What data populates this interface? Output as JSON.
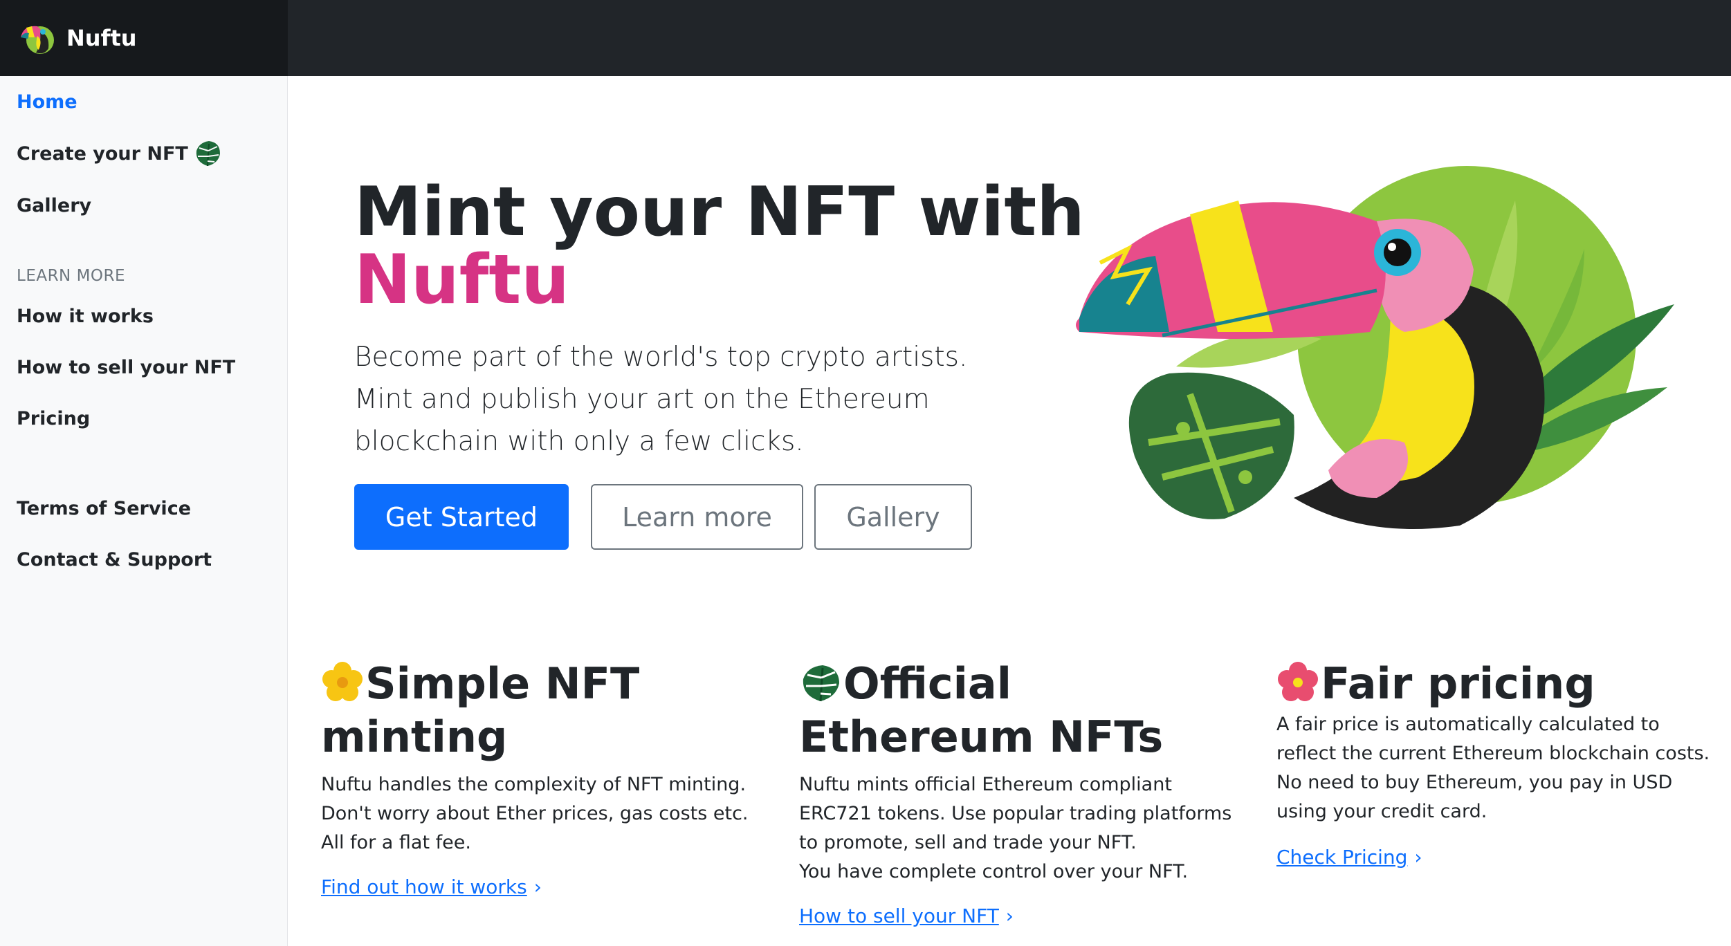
{
  "brand": {
    "name": "Nuftu",
    "logo_icon": "toucan-logo-icon"
  },
  "sidebar": {
    "items": [
      {
        "label": "Home",
        "active": true
      },
      {
        "label": "Create your NFT",
        "icon": "monstera-leaf-icon"
      },
      {
        "label": "Gallery"
      }
    ],
    "learn_heading": "LEARN MORE",
    "learn_items": [
      {
        "label": "How it works"
      },
      {
        "label": "How to sell your NFT"
      },
      {
        "label": "Pricing"
      }
    ],
    "footer_items": [
      {
        "label": "Terms of Service"
      },
      {
        "label": "Contact & Support"
      }
    ]
  },
  "hero": {
    "title_line1": "Mint your NFT with",
    "title_line2": "Nuftu",
    "lead": "Become part of the world's top crypto artists. Mint and publish your art on the Ethereum blockchain with only a few clicks.",
    "buttons": {
      "primary": "Get Started",
      "learn": "Learn more",
      "gallery": "Gallery"
    },
    "image": "toucan-illustration"
  },
  "features": [
    {
      "icon": "yellow-flower-icon",
      "title": "Simple NFT minting",
      "lines": [
        "Nuftu handles the complexity of NFT minting.",
        "Don't worry about Ether prices, gas costs etc.",
        "All for a flat fee."
      ],
      "link": "Find out how it works"
    },
    {
      "icon": "monstera-leaf-icon",
      "title": "Official Ethereum NFTs",
      "lines": [
        "Nuftu mints official Ethereum compliant ERC721 tokens. Use popular trading platforms to promote, sell and trade your NFT.",
        "You have complete control over your NFT."
      ],
      "link": "How to sell your NFT"
    },
    {
      "icon": "pink-flower-icon",
      "title": "Fair pricing",
      "lines": [
        "A fair price is automatically calculated to reflect the current Ethereum blockchain costs.",
        "No need to buy Ethereum, you pay in USD using your credit card."
      ],
      "link": "Check Pricing"
    }
  ],
  "colors": {
    "accent": "#d63384",
    "primary": "#0d6efd",
    "topbar": "#212529"
  }
}
